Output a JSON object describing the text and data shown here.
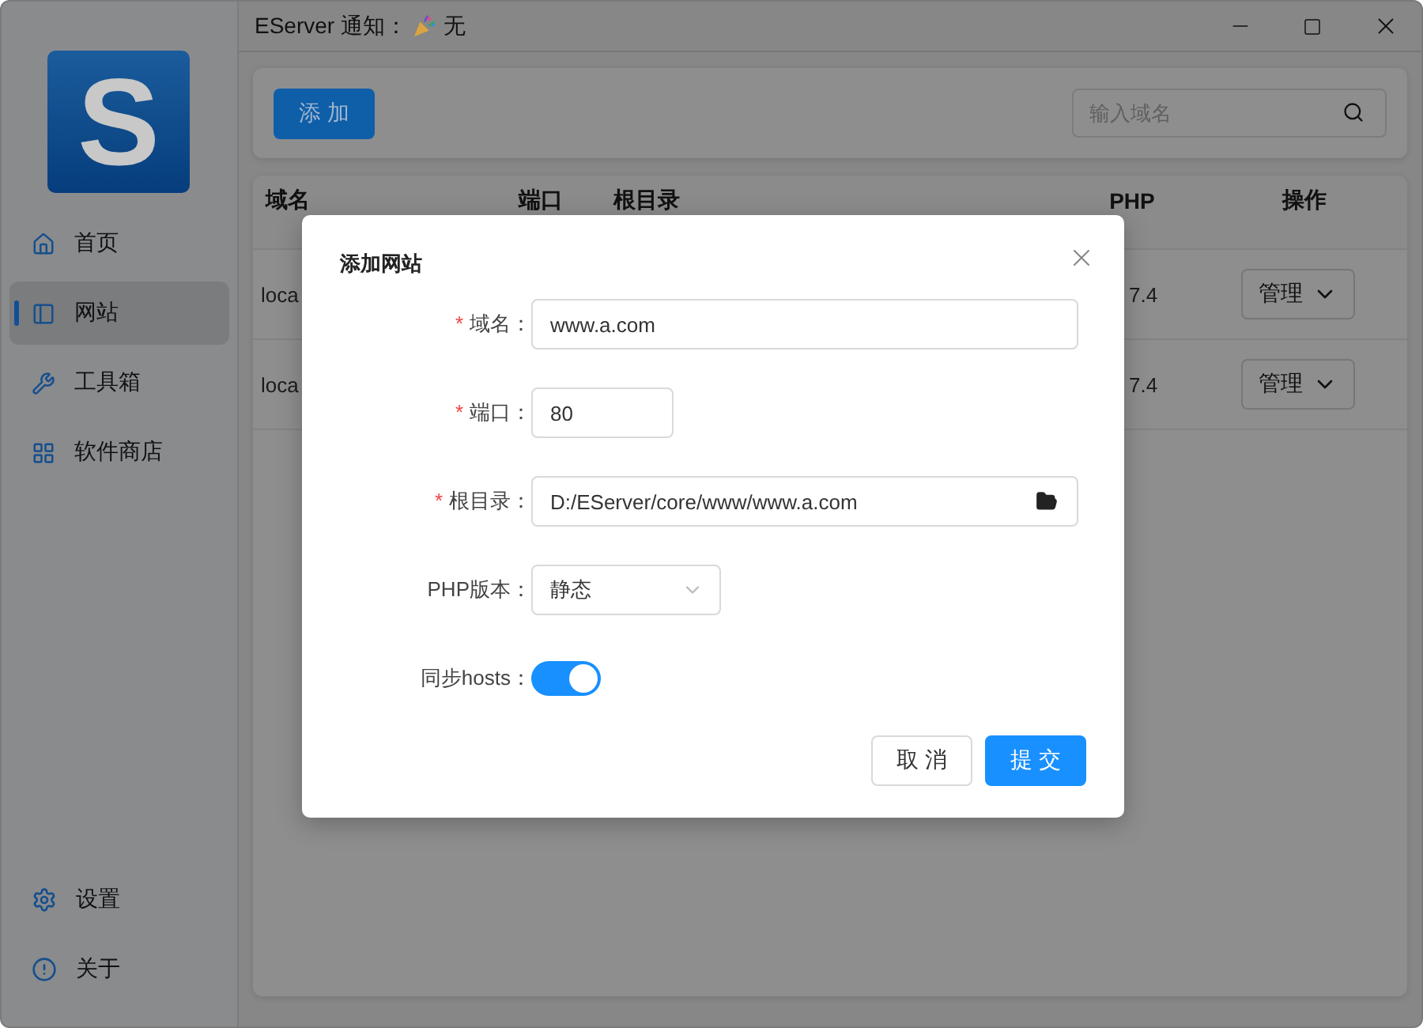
{
  "window": {
    "notification_label": "EServer 通知：",
    "notification": "无"
  },
  "sidebar": {
    "logo": "S",
    "items": [
      {
        "label": "首页",
        "selected": false
      },
      {
        "label": "网站",
        "selected": true
      },
      {
        "label": "工具箱",
        "selected": false
      },
      {
        "label": "软件商店",
        "selected": false
      }
    ],
    "bottom_items": [
      {
        "label": "设置"
      },
      {
        "label": "关于"
      }
    ]
  },
  "toolbar": {
    "add_button": "添 加",
    "search": {
      "placeholder": "输入域名"
    }
  },
  "table": {
    "columns": [
      "域名",
      "端口",
      "根目录",
      "PHP",
      "操作"
    ],
    "rows": [
      {
        "domain": "loca",
        "php": "7.4",
        "action": "管理"
      },
      {
        "domain": "loca",
        "php": "7.4",
        "action": "管理"
      }
    ]
  },
  "dialog": {
    "title": "添加网站",
    "fields": [
      {
        "kind": "text",
        "mark": "*",
        "label": "域名：",
        "value": "www.a.com"
      },
      {
        "kind": "number",
        "mark": "*",
        "label": "端口：",
        "value": "80"
      },
      {
        "kind": "path",
        "mark": "*",
        "label": "根目录：",
        "value": "D:/EServer/core/www/www.a.com"
      },
      {
        "kind": "select",
        "label": "PHP版本：",
        "value": "静态"
      },
      {
        "kind": "switch",
        "label": "同步hosts：",
        "on": true
      }
    ],
    "buttons": [
      {
        "kind": "cancel",
        "label": "取 消"
      },
      {
        "kind": "submit",
        "label": "提 交"
      }
    ]
  }
}
